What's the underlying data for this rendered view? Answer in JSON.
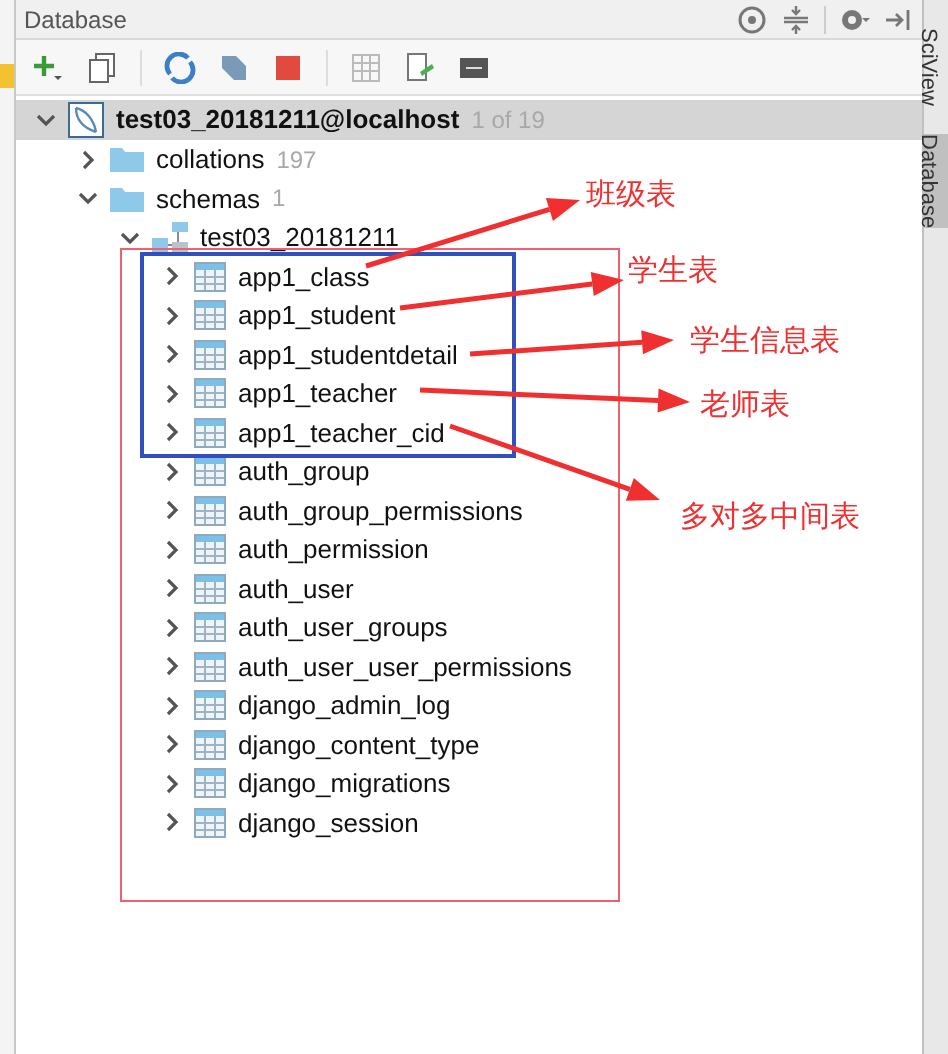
{
  "panel": {
    "title": "Database"
  },
  "tree": {
    "label": "test03_20181211@localhost",
    "count": "1 of 19",
    "kind": "database",
    "expanded": true,
    "children": [
      {
        "label": "collations",
        "count": "197",
        "kind": "folder",
        "expanded": false
      },
      {
        "label": "schemas",
        "count": "1",
        "kind": "folder",
        "expanded": true,
        "children": [
          {
            "label": "test03_20181211",
            "kind": "schema",
            "expanded": true,
            "children": [
              {
                "label": "app1_class",
                "kind": "table",
                "expanded": false
              },
              {
                "label": "app1_student",
                "kind": "table",
                "expanded": false
              },
              {
                "label": "app1_studentdetail",
                "kind": "table",
                "expanded": false
              },
              {
                "label": "app1_teacher",
                "kind": "table",
                "expanded": false
              },
              {
                "label": "app1_teacher_cid",
                "kind": "table",
                "expanded": false
              },
              {
                "label": "auth_group",
                "kind": "table",
                "expanded": false
              },
              {
                "label": "auth_group_permissions",
                "kind": "table",
                "expanded": false
              },
              {
                "label": "auth_permission",
                "kind": "table",
                "expanded": false
              },
              {
                "label": "auth_user",
                "kind": "table",
                "expanded": false
              },
              {
                "label": "auth_user_groups",
                "kind": "table",
                "expanded": false
              },
              {
                "label": "auth_user_user_permissions",
                "kind": "table",
                "expanded": false
              },
              {
                "label": "django_admin_log",
                "kind": "table",
                "expanded": false
              },
              {
                "label": "django_content_type",
                "kind": "table",
                "expanded": false
              },
              {
                "label": "django_migrations",
                "kind": "table",
                "expanded": false
              },
              {
                "label": "django_session",
                "kind": "table",
                "expanded": false
              }
            ]
          }
        ]
      }
    ]
  },
  "annotations": [
    {
      "label": "班级表"
    },
    {
      "label": "学生表"
    },
    {
      "label": "学生信息表"
    },
    {
      "label": "老师表"
    },
    {
      "label": "多对多中间表"
    }
  ],
  "side_tabs": [
    {
      "label": "SciView",
      "selected": false
    },
    {
      "label": "Database",
      "selected": true
    }
  ]
}
